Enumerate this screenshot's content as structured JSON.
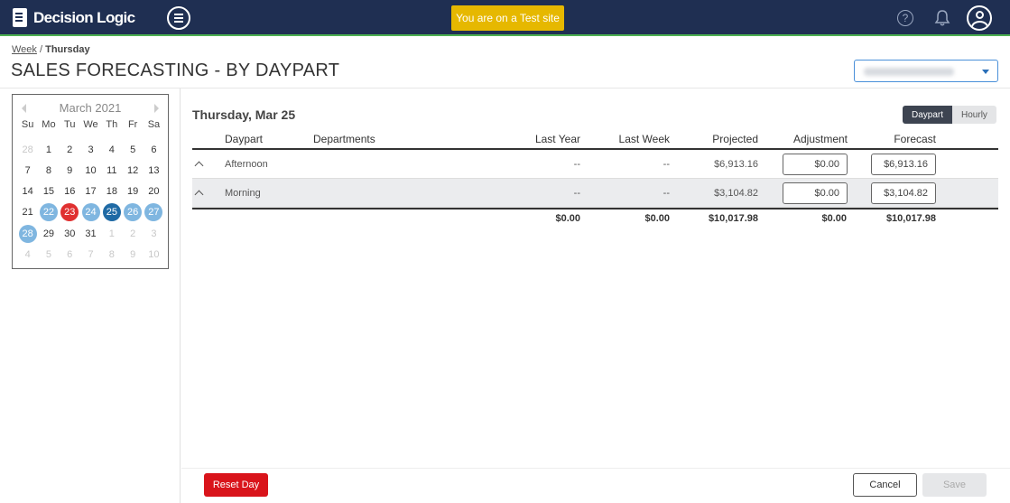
{
  "app": {
    "name": "Decision Logic",
    "test_banner": "You are on a Test site"
  },
  "icons": {
    "menu": "menu-icon",
    "help": "help-icon",
    "bell": "bell-icon",
    "user": "user-icon"
  },
  "breadcrumb": {
    "parent": "Week",
    "separator": "/",
    "current": "Thursday"
  },
  "page": {
    "title": "SALES FORECASTING - BY DAYPART"
  },
  "calendar": {
    "month_label": "March 2021",
    "weekdays": [
      "Su",
      "Mo",
      "Tu",
      "We",
      "Th",
      "Fr",
      "Sa"
    ],
    "days": [
      {
        "label": "28",
        "state": "muted"
      },
      {
        "label": "1",
        "state": ""
      },
      {
        "label": "2",
        "state": ""
      },
      {
        "label": "3",
        "state": ""
      },
      {
        "label": "4",
        "state": ""
      },
      {
        "label": "5",
        "state": ""
      },
      {
        "label": "6",
        "state": ""
      },
      {
        "label": "7",
        "state": ""
      },
      {
        "label": "8",
        "state": ""
      },
      {
        "label": "9",
        "state": ""
      },
      {
        "label": "10",
        "state": ""
      },
      {
        "label": "11",
        "state": ""
      },
      {
        "label": "12",
        "state": ""
      },
      {
        "label": "13",
        "state": ""
      },
      {
        "label": "14",
        "state": ""
      },
      {
        "label": "15",
        "state": ""
      },
      {
        "label": "16",
        "state": ""
      },
      {
        "label": "17",
        "state": ""
      },
      {
        "label": "18",
        "state": ""
      },
      {
        "label": "19",
        "state": ""
      },
      {
        "label": "20",
        "state": ""
      },
      {
        "label": "21",
        "state": ""
      },
      {
        "label": "22",
        "state": "week"
      },
      {
        "label": "23",
        "state": "today"
      },
      {
        "label": "24",
        "state": "week"
      },
      {
        "label": "25",
        "state": "selected"
      },
      {
        "label": "26",
        "state": "week"
      },
      {
        "label": "27",
        "state": "week"
      },
      {
        "label": "28",
        "state": "week"
      },
      {
        "label": "29",
        "state": ""
      },
      {
        "label": "30",
        "state": ""
      },
      {
        "label": "31",
        "state": ""
      },
      {
        "label": "1",
        "state": "muted"
      },
      {
        "label": "2",
        "state": "muted"
      },
      {
        "label": "3",
        "state": "muted"
      },
      {
        "label": "4",
        "state": "muted"
      },
      {
        "label": "5",
        "state": "muted"
      },
      {
        "label": "6",
        "state": "muted"
      },
      {
        "label": "7",
        "state": "muted"
      },
      {
        "label": "8",
        "state": "muted"
      },
      {
        "label": "9",
        "state": "muted"
      },
      {
        "label": "10",
        "state": "muted"
      }
    ]
  },
  "main": {
    "date_title": "Thursday, Mar 25",
    "view_toggle": {
      "daypart": "Daypart",
      "hourly": "Hourly",
      "selected": "Daypart"
    },
    "columns": {
      "daypart": "Daypart",
      "departments": "Departments",
      "last_year": "Last Year",
      "last_week": "Last Week",
      "projected": "Projected",
      "adjustment": "Adjustment",
      "forecast": "Forecast"
    },
    "rows": [
      {
        "daypart": "Afternoon",
        "last_year": "--",
        "last_week": "--",
        "projected": "$6,913.16",
        "adjustment": "$0.00",
        "forecast": "$6,913.16"
      },
      {
        "daypart": "Morning",
        "last_year": "--",
        "last_week": "--",
        "projected": "$3,104.82",
        "adjustment": "$0.00",
        "forecast": "$3,104.82"
      }
    ],
    "totals": {
      "last_year": "$0.00",
      "last_week": "$0.00",
      "projected": "$10,017.98",
      "adjustment": "$0.00",
      "forecast": "$10,017.98"
    }
  },
  "footer": {
    "reset": "Reset Day",
    "cancel": "Cancel",
    "save": "Save"
  },
  "colors": {
    "topbar": "#1f2f52",
    "accent_green": "#4caf50",
    "banner": "#e6b800",
    "reset": "#d9141b",
    "selected_day": "#1f6aa5",
    "week_day": "#7fb6e0",
    "today": "#e03030"
  }
}
